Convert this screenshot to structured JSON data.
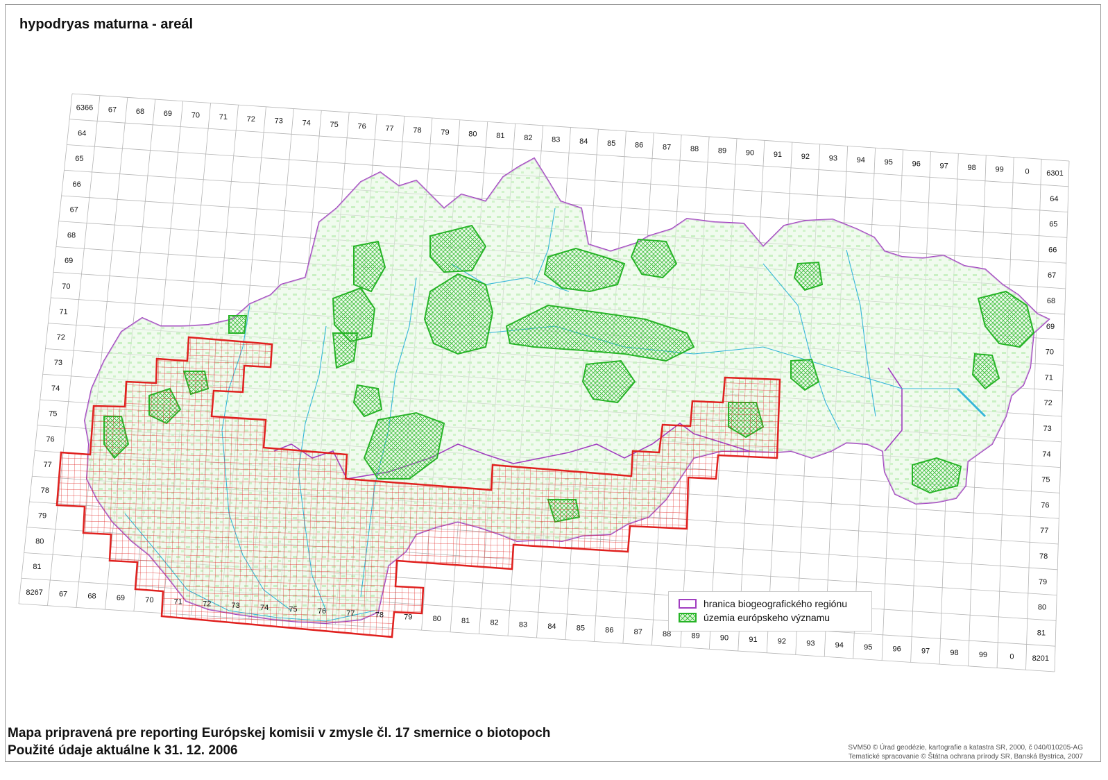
{
  "title": "hypodryas maturna - areál",
  "footer": {
    "line1": "Mapa pripravená pre reporting Európskej komisii v zmysle čl. 17 smernice o biotopoch",
    "line2": "Použité údaje aktuálne k 31. 12. 2006"
  },
  "credits": {
    "line1": "SVM50 © Úrad geodézie, kartografie a katastra SR, 2000, č 040/010205-AG",
    "line2": "Tematické spracovanie © Štátna ochrana prírody SR, Banská Bystrica, 2007"
  },
  "legend": {
    "items": [
      {
        "label": "hranica biogeografického regiónu",
        "color": "#a13ec0"
      },
      {
        "label": "územia európskeho významu",
        "color": "#27b427"
      }
    ]
  },
  "grid": {
    "top_labels": [
      "6366",
      "67",
      "68",
      "69",
      "70",
      "71",
      "72",
      "73",
      "74",
      "75",
      "76",
      "77",
      "78",
      "79",
      "80",
      "81",
      "82",
      "83",
      "84",
      "85",
      "86",
      "87",
      "88",
      "89",
      "90",
      "91",
      "92",
      "93",
      "94",
      "95",
      "96",
      "97",
      "98",
      "99",
      "0",
      "6301"
    ],
    "left_labels": [
      "64",
      "65",
      "66",
      "67",
      "68",
      "69",
      "70",
      "71",
      "72",
      "73",
      "74",
      "75",
      "76",
      "77",
      "78",
      "79",
      "80",
      "81",
      "8267"
    ],
    "right_labels": [
      "64",
      "65",
      "66",
      "67",
      "68",
      "69",
      "70",
      "71",
      "72",
      "73",
      "74",
      "75",
      "76",
      "77",
      "78",
      "79",
      "80",
      "81",
      "8201"
    ],
    "bottom_labels": [
      "67",
      "68",
      "69",
      "70",
      "71",
      "72",
      "73",
      "74",
      "75",
      "76",
      "77",
      "78",
      "79",
      "80",
      "81",
      "82",
      "83",
      "84",
      "85",
      "86",
      "87",
      "88",
      "89",
      "90",
      "91",
      "92",
      "93",
      "94",
      "95",
      "96",
      "97",
      "98",
      "99",
      "0"
    ]
  },
  "colors": {
    "region_border": "#a13ec0",
    "sci_sites": "#27b427",
    "area_outline": "#e0201e",
    "land_fill": "#d9f5d4",
    "water": "#35b6d8"
  }
}
